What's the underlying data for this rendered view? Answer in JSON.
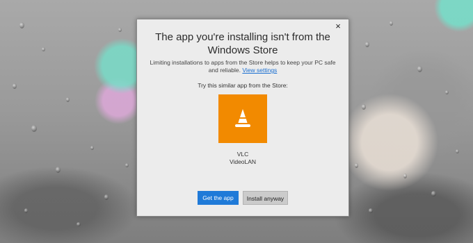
{
  "dialog": {
    "close_glyph": "×",
    "title": "The app you're installing isn't from the Windows Store",
    "description": "Limiting installations to apps from the Store helps to keep your PC safe and reliable.",
    "settings_link": "View settings",
    "suggestion_label": "Try this similar app from the Store:",
    "app": {
      "name": "VLC",
      "publisher": "VideoLAN",
      "icon": "traffic-cone-icon",
      "tile_color": "#f28a00"
    },
    "get_app_label": "Get the app",
    "install_anyway_label": "Install anyway"
  },
  "colors": {
    "accent": "#1f7ad8",
    "link": "#1a6fd1",
    "dialog_bg": "#ececec"
  }
}
